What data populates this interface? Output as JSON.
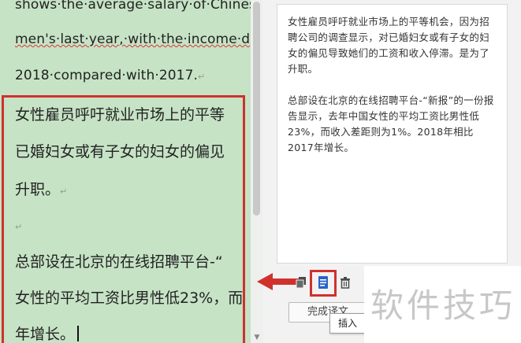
{
  "document": {
    "lines": [
      {
        "text": "shows·the·average·salary·of·Chines",
        "kind": "en"
      },
      {
        "text": "men's·last·year,·with·the·income·d",
        "kind": "en"
      },
      {
        "text": "2018·compared·with·2017.",
        "kind": "en",
        "mark": "↵"
      },
      {
        "text": "女性雇员呼吁就业市场上的平等",
        "kind": "zh"
      },
      {
        "text": "已婚妇女或有子女的妇女的偏见",
        "kind": "zh"
      },
      {
        "text": "升职。",
        "kind": "zh",
        "mark": "↵"
      },
      {
        "text": "",
        "kind": "zh",
        "mark": "↵"
      },
      {
        "text": "总部设在北京的在线招聘平台-“",
        "kind": "zh"
      },
      {
        "text": "女性的平均工资比男性低23%，而",
        "kind": "zh"
      },
      {
        "text": "年增长。",
        "kind": "zh"
      }
    ]
  },
  "pane": {
    "paragraph1": "女性雇员呼吁就业市场上的平等机会，因为招聘公司的调查显示，对已婚妇女或有子女的妇女的偏见导致她们的工资和收入停滞。是为了升职。",
    "paragraph2": "总部设在北京的在线招聘平台-“新报”的一份报告显示，去年中国女性的平均工资比男性低23%，而收入差距则为1%。2018年相比2017年增长。",
    "finish_label": "完成译文",
    "tooltip": "插入"
  },
  "watermark": "软件技巧",
  "colors": {
    "doc_bg": "#c6e3c5",
    "highlight": "#d0312d",
    "insert_blue": "#2b63c7"
  }
}
